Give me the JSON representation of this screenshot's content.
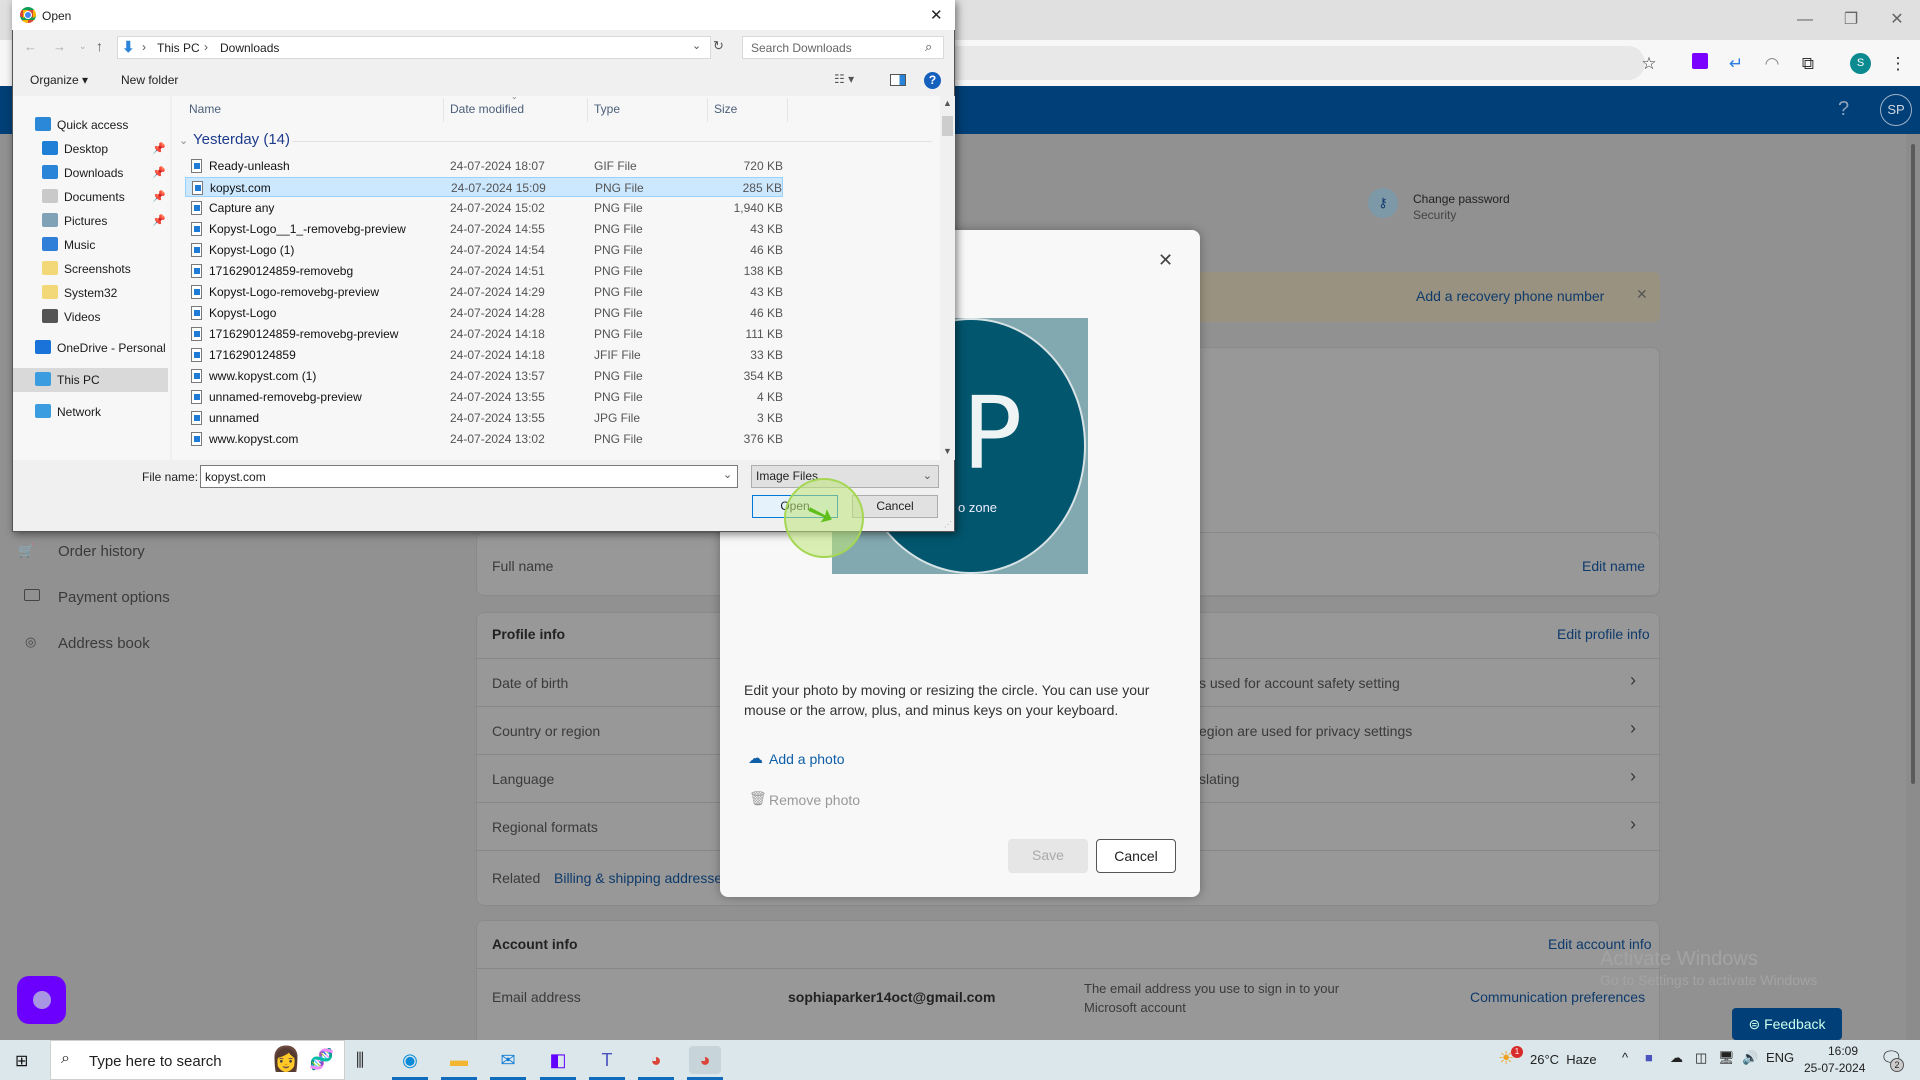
{
  "browser": {
    "window_controls": {
      "minimize": "—",
      "restore": "❐",
      "close": "✕"
    },
    "extensions": [
      "extension-purple-icon",
      "extension-blue-icon",
      "extension-arc-icon",
      "extensions-puzzle-icon"
    ],
    "profile_initial": "S"
  },
  "ms_header": {
    "help": "?",
    "avatar_initials": "SP"
  },
  "page": {
    "change_password": {
      "title": "Change password",
      "subtitle": "Security"
    },
    "recovery_banner": "Add a recovery phone number",
    "sidebar": [
      {
        "label": "Order history",
        "icon": "cart-icon"
      },
      {
        "label": "Payment options",
        "icon": "card-icon"
      },
      {
        "label": "Address book",
        "icon": "location-icon"
      }
    ],
    "full_name_label": "Full name",
    "edit_name": "Edit name",
    "profile_info": {
      "title": "Profile info",
      "edit": "Edit profile info",
      "rows": [
        {
          "label": "Date of birth",
          "desc": "s used for account safety setting"
        },
        {
          "label": "Country or region",
          "desc": "egion are used for privacy settings"
        },
        {
          "label": "Language",
          "desc": "slating"
        },
        {
          "label": "Regional formats",
          "desc": ""
        }
      ],
      "related_label": "Related",
      "related_link": "Billing & shipping addresses"
    },
    "account_info": {
      "title": "Account info",
      "edit": "Edit account info",
      "email_label": "Email address",
      "email_value": "sophiaparker14oct@gmail.com",
      "email_desc": "The email address you use to sign in to your Microsoft account",
      "comm_prefs": "Communication preferences"
    },
    "feedback": "Feedback",
    "watermark": {
      "title": "Activate Windows",
      "subtitle": "Go to Settings to activate Windows"
    }
  },
  "photo_dialog": {
    "close": "✕",
    "photo_letter": "P",
    "photo_caption": "o zone",
    "instructions": "Edit your photo by moving or resizing the circle. You can use your mouse or the arrow, plus, and minus keys on your keyboard.",
    "add_photo": "Add a photo",
    "remove_photo": "Remove photo",
    "save": "Save",
    "cancel": "Cancel"
  },
  "file_dialog": {
    "title": "Open",
    "close": "✕",
    "breadcrumb": [
      "This PC",
      "Downloads"
    ],
    "search_placeholder": "Search Downloads",
    "organize": "Organize ▾",
    "new_folder": "New folder",
    "nav": [
      {
        "label": "Quick access",
        "icon": "star-icon",
        "color": "#2b88d8",
        "indent": 0
      },
      {
        "label": "Desktop",
        "icon": "desktop-icon",
        "color": "#1f7fd6",
        "indent": 1,
        "pinned": true
      },
      {
        "label": "Downloads",
        "icon": "download-arrow-icon",
        "color": "#2a85d8",
        "indent": 1,
        "pinned": true
      },
      {
        "label": "Documents",
        "icon": "documents-icon",
        "color": "#c9c9c9",
        "indent": 1,
        "pinned": true
      },
      {
        "label": "Pictures",
        "icon": "pictures-icon",
        "color": "#7fa2b6",
        "indent": 1,
        "pinned": true
      },
      {
        "label": "Music",
        "icon": "music-icon",
        "color": "#2f7fd8",
        "indent": 1
      },
      {
        "label": "Screenshots",
        "icon": "folder-icon",
        "color": "#f3d87a",
        "indent": 1
      },
      {
        "label": "System32",
        "icon": "folder-icon",
        "color": "#f3d87a",
        "indent": 1
      },
      {
        "label": "Videos",
        "icon": "videos-icon",
        "color": "#555555",
        "indent": 1
      },
      {
        "label": "OneDrive - Personal",
        "icon": "cloud-icon",
        "color": "#1a73d9",
        "indent": 0
      },
      {
        "label": "This PC",
        "icon": "computer-icon",
        "color": "#3b9de0",
        "indent": 0,
        "selected": true
      },
      {
        "label": "Network",
        "icon": "network-icon",
        "color": "#3b9de0",
        "indent": 0
      }
    ],
    "columns": [
      "Name",
      "Date modified",
      "Type",
      "Size"
    ],
    "group": "Yesterday (14)",
    "files": [
      {
        "name": "Ready-unleash",
        "date": "24-07-2024 18:07",
        "type": "GIF File",
        "size": "720 KB"
      },
      {
        "name": "kopyst.com",
        "date": "24-07-2024 15:09",
        "type": "PNG File",
        "size": "285 KB",
        "selected": true
      },
      {
        "name": "Capture any",
        "date": "24-07-2024 15:02",
        "type": "PNG File",
        "size": "1,940 KB"
      },
      {
        "name": "Kopyst-Logo__1_-removebg-preview",
        "date": "24-07-2024 14:55",
        "type": "PNG File",
        "size": "43 KB"
      },
      {
        "name": "Kopyst-Logo (1)",
        "date": "24-07-2024 14:54",
        "type": "PNG File",
        "size": "46 KB"
      },
      {
        "name": "1716290124859-removebg",
        "date": "24-07-2024 14:51",
        "type": "PNG File",
        "size": "138 KB"
      },
      {
        "name": "Kopyst-Logo-removebg-preview",
        "date": "24-07-2024 14:29",
        "type": "PNG File",
        "size": "43 KB"
      },
      {
        "name": "Kopyst-Logo",
        "date": "24-07-2024 14:28",
        "type": "PNG File",
        "size": "46 KB"
      },
      {
        "name": "1716290124859-removebg-preview",
        "date": "24-07-2024 14:18",
        "type": "PNG File",
        "size": "111 KB"
      },
      {
        "name": "1716290124859",
        "date": "24-07-2024 14:18",
        "type": "JFIF File",
        "size": "33 KB"
      },
      {
        "name": "www.kopyst.com (1)",
        "date": "24-07-2024 13:57",
        "type": "PNG File",
        "size": "354 KB"
      },
      {
        "name": "unnamed-removebg-preview",
        "date": "24-07-2024 13:55",
        "type": "PNG File",
        "size": "4 KB"
      },
      {
        "name": "unnamed",
        "date": "24-07-2024 13:55",
        "type": "JPG File",
        "size": "3 KB"
      },
      {
        "name": "www.kopyst.com",
        "date": "24-07-2024 13:02",
        "type": "PNG File",
        "size": "376 KB"
      }
    ],
    "file_name_label": "File name:",
    "file_name_value": "kopyst.com",
    "file_type": "Image Files",
    "open": "Open",
    "cancel": "Cancel"
  },
  "taskbar": {
    "search_placeholder": "Type here to search",
    "apps": [
      "task-view-icon",
      "edge-icon",
      "file-explorer-icon",
      "mail-icon",
      "power-automate-icon",
      "teams-icon",
      "chrome-a-icon",
      "chrome-s-icon"
    ],
    "weather": "26°C  Haze",
    "weather_badge": "1",
    "language": "ENG",
    "time": "16:09",
    "date": "25-07-2024",
    "notifications": "2"
  }
}
